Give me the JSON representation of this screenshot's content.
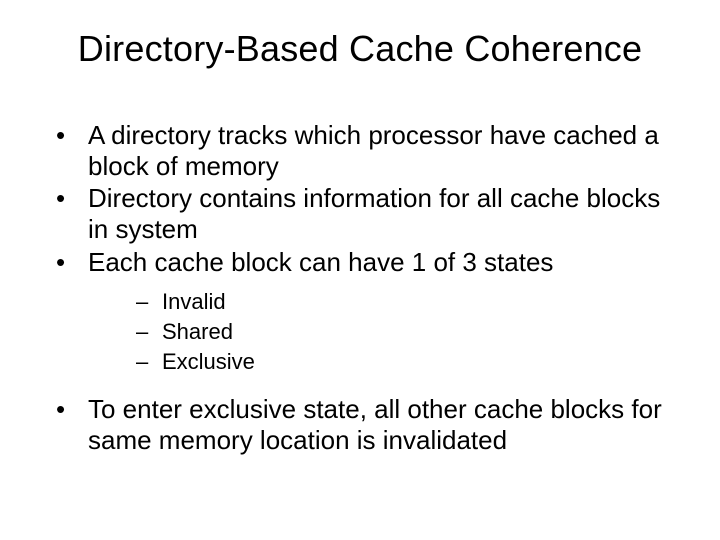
{
  "title": "Directory-Based Cache Coherence",
  "bullets": {
    "b1": "A directory tracks which processor have cached a block of memory",
    "b2": "Directory contains information for all cache blocks in system",
    "b3": "Each cache block can have 1 of 3 states",
    "sub": {
      "s1": "Invalid",
      "s2": "Shared",
      "s3": "Exclusive"
    },
    "b4": "To enter exclusive state, all other cache blocks for same memory location is invalidated"
  }
}
